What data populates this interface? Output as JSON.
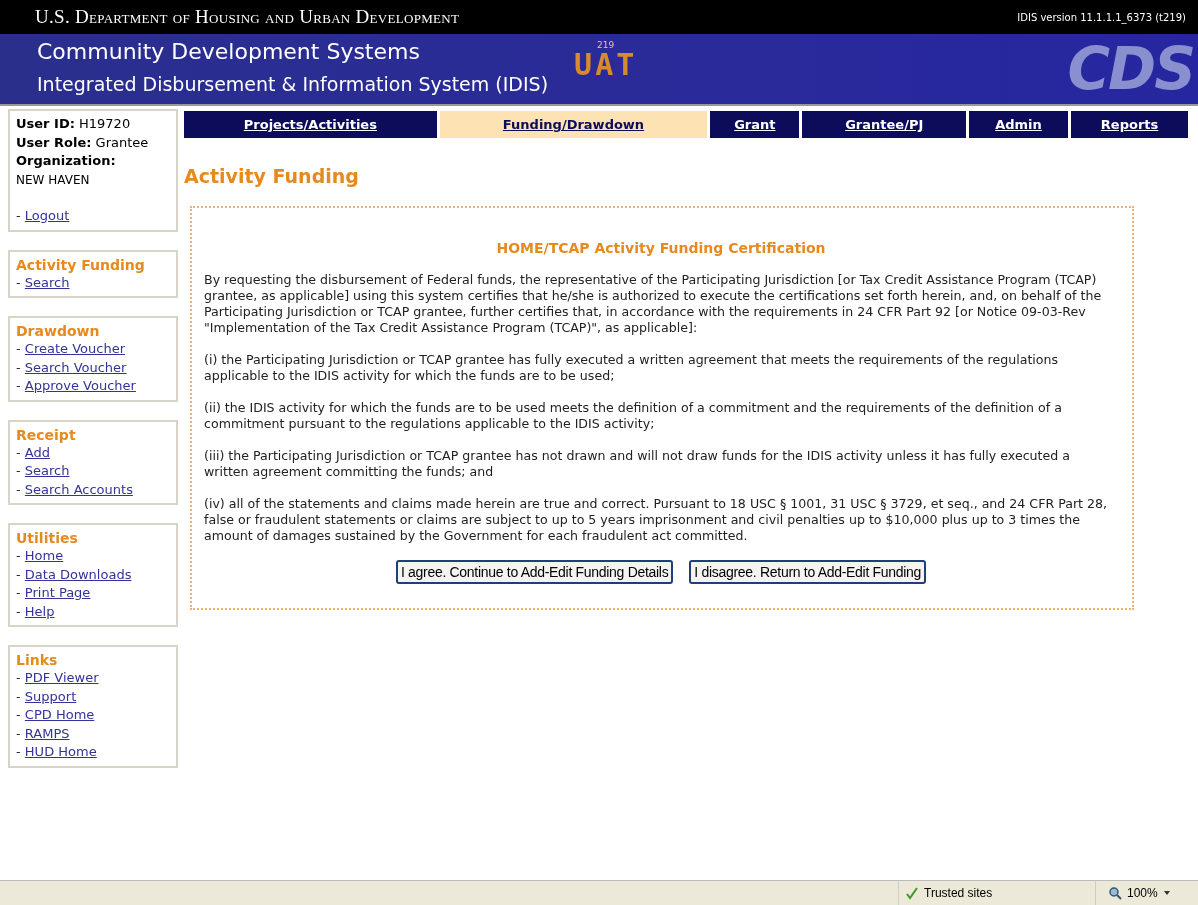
{
  "header": {
    "agency": "U.S. Department of Housing and Urban Development",
    "version": "IDIS version 11.1.1.1_6373 (t219)"
  },
  "banner": {
    "title": "Community Development Systems",
    "subtitle": "Integrated Disbursement & Information System (IDIS)",
    "build": "219",
    "badge": "UAT",
    "logo": "CDS"
  },
  "user_info": {
    "user_id_label": "User ID:",
    "user_id": "H19720",
    "role_label": "User Role:",
    "role": "Grantee",
    "org_label": "Organization:",
    "org": "NEW HAVEN",
    "logout_dash": "-",
    "logout": "Logout"
  },
  "sidebar": [
    {
      "title": "Activity Funding",
      "items": [
        {
          "dash": "-",
          "label": "Search"
        }
      ]
    },
    {
      "title": "Drawdown",
      "items": [
        {
          "dash": "-",
          "label": "Create Voucher"
        },
        {
          "dash": "-",
          "label": "Search Voucher"
        },
        {
          "dash": "-",
          "label": "Approve Voucher"
        }
      ]
    },
    {
      "title": "Receipt",
      "items": [
        {
          "dash": "-",
          "label": "Add"
        },
        {
          "dash": "-",
          "label": "Search"
        },
        {
          "dash": "-",
          "label": "Search Accounts"
        }
      ]
    },
    {
      "title": "Utilities",
      "items": [
        {
          "dash": "-",
          "label": "Home"
        },
        {
          "dash": "-",
          "label": "Data Downloads"
        },
        {
          "dash": "-",
          "label": "Print Page"
        },
        {
          "dash": "-",
          "label": "Help"
        }
      ]
    },
    {
      "title": "Links",
      "items": [
        {
          "dash": "-",
          "label": "PDF Viewer"
        },
        {
          "dash": "-",
          "label": "Support"
        },
        {
          "dash": "-",
          "label": "CPD Home"
        },
        {
          "dash": "-",
          "label": "RAMPS"
        },
        {
          "dash": "-",
          "label": "HUD Home"
        }
      ]
    }
  ],
  "tabs": [
    {
      "label": "Projects/Activities",
      "selected": false
    },
    {
      "label": "Funding/Drawdown",
      "selected": true
    },
    {
      "label": "Grant",
      "selected": false
    },
    {
      "label": "Grantee/PJ",
      "selected": false
    },
    {
      "label": "Admin",
      "selected": false
    },
    {
      "label": "Reports",
      "selected": false
    }
  ],
  "page_title": "Activity Funding",
  "certification": {
    "title": "HOME/TCAP Activity Funding Certification",
    "paragraphs": [
      "By requesting the disbursement of Federal funds, the representative of the Participating Jurisdiction [or Tax Credit Assistance Program (TCAP) grantee, as applicable] using this system certifies that he/she is authorized to execute the certifications set forth herein, and, on behalf of the Participating Jurisdiction or TCAP grantee, further certifies that, in accordance with the requirements in 24 CFR Part 92 [or Notice 09-03-Rev \"Implementation of the Tax Credit Assistance Program (TCAP)\", as applicable]:",
      "(i) the Participating Jurisdiction or TCAP grantee has fully executed a written agreement that meets the requirements of the regulations applicable to the IDIS activity for which the funds are to be used;",
      "(ii) the IDIS activity for which the funds are to be used meets the definition of a commitment and the requirements of the definition of a commitment pursuant to the regulations applicable to the IDIS activity;",
      "(iii) the Participating Jurisdiction or TCAP grantee has not drawn and will not draw funds for the IDIS activity unless it has fully executed a written agreement committing the funds; and",
      "(iv) all of the statements and claims made herein are true and correct. Pursuant to 18 USC § 1001, 31 USC § 3729, et seq., and 24 CFR Part 28, false or fraudulent statements or claims are subject to up to 5 years imprisonment and civil penalties up to $10,000 plus up to 3 times the amount of damages sustained by the Government for each fraudulent act committed."
    ],
    "buttons": [
      "I agree. Continue to Add-Edit Funding Details",
      "I disagree. Return to Add-Edit Funding"
    ]
  },
  "status_bar": {
    "zone": "Trusted sites",
    "zoom": "100%"
  }
}
